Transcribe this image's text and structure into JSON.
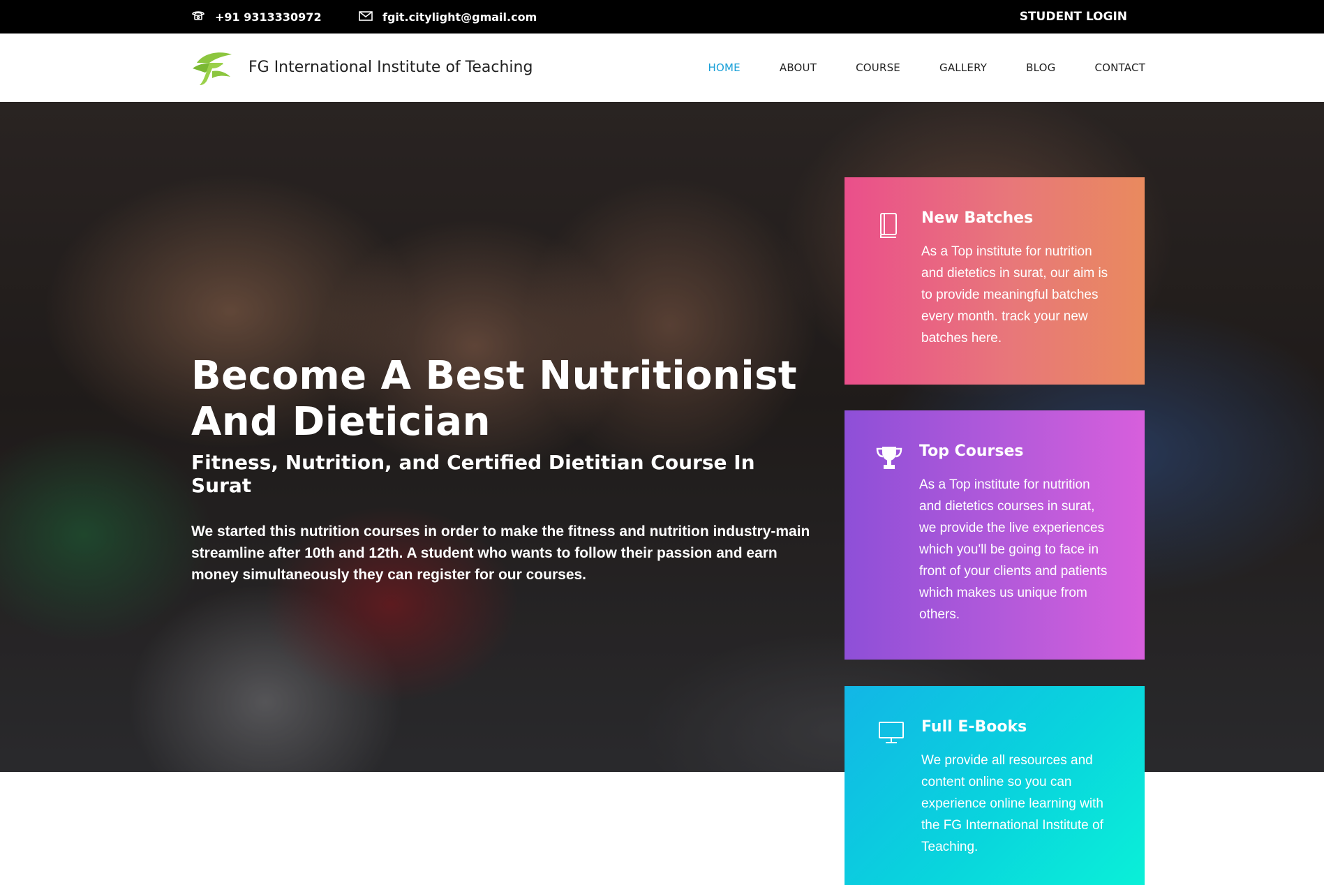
{
  "topbar": {
    "phone": "+91 9313330972",
    "email": "fgit.citylight@gmail.com",
    "login_label": "STUDENT LOGIN"
  },
  "header": {
    "brand_name": "FG International Institute of Teaching",
    "nav": {
      "home": "HOME",
      "about": "ABOUT",
      "course": "COURSE",
      "gallery": "GALLERY",
      "blog": "BLOG",
      "contact": "CONTACT"
    },
    "active_nav": "HOME"
  },
  "hero": {
    "title_line1": "Become A Best Nutritionist",
    "title_line2": "And Dietician",
    "subtitle": "Fitness, Nutrition, and Certified Dietitian Course In Surat",
    "text": "We started this nutrition courses in order to make the fitness and nutrition industry-main streamline after 10th and 12th. A student who wants to follow their passion and earn money simultaneously they can register for our courses."
  },
  "cards": [
    {
      "icon": "book-icon",
      "title": "New Batches",
      "text": "As a Top institute for nutrition and dietetics in surat, our aim is to provide meaningful batches every month. track your new batches here."
    },
    {
      "icon": "trophy-icon",
      "title": "Top Courses",
      "text": "As a Top institute for nutrition and dietetics courses in surat, we provide the live experiences which you'll be going to face in front of your clients and patients which makes us unique from others."
    },
    {
      "icon": "monitor-icon",
      "title": "Full E-Books",
      "text": "We provide all resources and content online so you can experience online learning with the FG International Institute of Teaching."
    }
  ],
  "colors": {
    "nav_active": "#1aa0d8",
    "topbar_bg": "#000000",
    "card1_gradient": [
      "#ea4f8b",
      "#e98a5e"
    ],
    "card2_gradient": [
      "#8e4fd8",
      "#d75fdc"
    ],
    "card3_gradient": [
      "#12b6e6",
      "#0af0d8"
    ],
    "logo_green": "#8cc63f"
  }
}
